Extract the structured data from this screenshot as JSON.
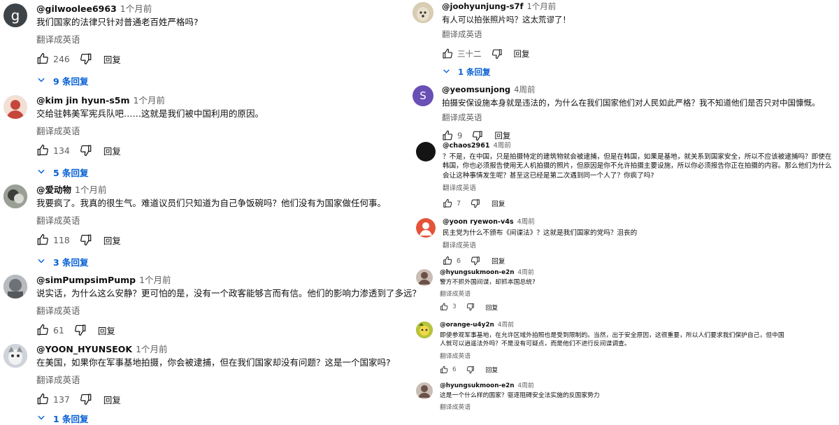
{
  "common": {
    "translate_label": "翻译成英语",
    "reply_label": "回复"
  },
  "left_comments": [
    {
      "author": "@gilwoolee6963",
      "time": "1个月前",
      "text": "我们国家的法律只针对普通老百姓严格吗?",
      "likes": "246",
      "replies": "9 条回复",
      "avatar_letter": "g",
      "avatar_color": "#3d4347"
    },
    {
      "author": "@kim jin hyun-s5m",
      "time": "1个月前",
      "text": "交给驻韩美军宪兵队吧……这就是我们被中国利用的原因。",
      "likes": "134",
      "replies": "5 条回复",
      "avatar_color": "#c5473b"
    },
    {
      "author": "@爱动物",
      "time": "1个月前",
      "text": "我要疯了。我真的很生气。难道议员们只知道为自己争饭碗吗？他们没有为国家做任何事。",
      "likes": "118",
      "replies": "3 条回复",
      "avatar_color": "#5a5f57"
    },
    {
      "author": "@simPumpsimPump",
      "time": "1个月前",
      "text": "说实话，为什么这么安静？更可怕的是，没有一个政客能够言而有信。他们的影响力渗透到了多远？",
      "likes": "61",
      "avatar_color": "#8c8f94"
    },
    {
      "author": "@YOON_HYUNSEOK",
      "time": "1个月前",
      "text": "在美国，如果你在军事基地拍摄，你会被逮捕，但在我们国家却没有问题？这是一个国家吗?",
      "likes": "137",
      "replies": "1 条回复",
      "avatar_color": "#b9bcc3"
    }
  ],
  "right_comments": [
    {
      "author": "@joohyunjung-s7f",
      "time": "1个月前",
      "text": "有人可以拍张照片吗？这太荒谬了！",
      "likes": "三十二",
      "replies": "1 条回复",
      "avatar_color": "#c8b79a"
    },
    {
      "author": "@yeomsunjong",
      "time": "4周前",
      "text": "拍摄安保设施本身就是违法的，为什么在我们国家他们对人民如此严格？我不知道他们是否只对中国慷慨。",
      "likes": "9",
      "avatar_letter": "S",
      "avatar_color": "#6a4fb5"
    },
    {
      "author": "@chaos2961",
      "time": "4周前",
      "text": "？不是，在中国，只是拍摄特定的建筑物就会被逮捕，但是在韩国，如果是基地，就关系到国家安全，所以不应该被逮捕吗？即使在韩国，你也必须报告使用无人机拍摄的照片，但原因是你不允许拍摄主要设施，所以你必须报告你正在拍摄的内容。那么他们为什么会让这种事情发生呢？甚至这已经是第二次遇到同一个人了？你疯了吗?",
      "likes": "7",
      "avatar_color": "#141414"
    },
    {
      "author": "@yoon ryewon-v4s",
      "time": "4周前",
      "text": "民主党为什么不颁布《间谍法》？这就是我们国家的党吗？沮丧的",
      "likes": "6",
      "avatar_color": "#e5533a"
    },
    {
      "author": "@hyungsukmoon-e2n",
      "time": "4周前",
      "text": "警方不抓外国间谍，却抓本国总统?",
      "likes": "3",
      "avatar_color": "#6b5248"
    },
    {
      "author": "@orange-u4y2n",
      "time": "4周前",
      "text": "即使参观军事基地，在允许区域外拍照也是受到限制的。当然，出于安全原因，这很重要，所以人们要求我们保护自己，但中国人就可以逍遥法外吗？不是没有可疑点，而是他们不进行反间谍调查。",
      "likes": "6",
      "avatar_color": "#8a9a2e"
    },
    {
      "author": "@hyungsukmoon-e2n",
      "time": "4周前",
      "text": "这是一个什么样的国家？驱逐阻碍安全法实施的反国家势力",
      "avatar_color": "#6b5248"
    }
  ]
}
